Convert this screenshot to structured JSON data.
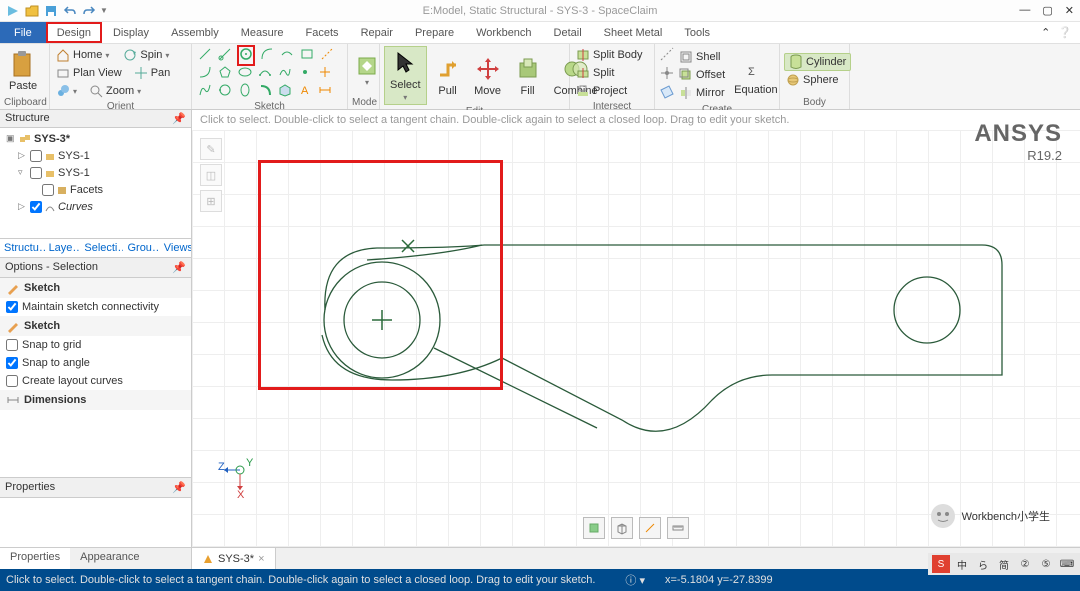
{
  "title": "E:Model, Static Structural - SYS-3 - SpaceClaim",
  "menu": {
    "file": "File",
    "tabs": [
      "Design",
      "Display",
      "Assembly",
      "Measure",
      "Facets",
      "Repair",
      "Prepare",
      "Workbench",
      "Detail",
      "Sheet Metal",
      "Tools"
    ]
  },
  "ribbon": {
    "clipboard": {
      "label": "Clipboard",
      "paste": "Paste"
    },
    "orient": {
      "label": "Orient",
      "home": "Home",
      "plan": "Plan View",
      "spin": "Spin",
      "pan": "Pan",
      "zoom": "Zoom"
    },
    "sketch": {
      "label": "Sketch"
    },
    "mode": {
      "label": "Mode"
    },
    "edit": {
      "label": "Edit",
      "select": "Select",
      "pull": "Pull",
      "move": "Move",
      "fill": "Fill",
      "combine": "Combine"
    },
    "intersect": {
      "label": "Intersect",
      "splitbody": "Split Body",
      "split": "Split",
      "project": "Project"
    },
    "create": {
      "label": "Create",
      "shell": "Shell",
      "offset": "Offset",
      "mirror": "Mirror",
      "equation": "Equation"
    },
    "body": {
      "label": "Body",
      "cylinder": "Cylinder",
      "sphere": "Sphere"
    }
  },
  "structure": {
    "title": "Structure",
    "root": "SYS-3*",
    "items": [
      "SYS-1",
      "SYS-1",
      "Facets",
      "Curves"
    ]
  },
  "paneltabs": [
    "Structu…",
    "Laye…",
    "Selecti…",
    "Grou…",
    "Views"
  ],
  "options": {
    "title": "Options - Selection",
    "sec1": "Sketch",
    "maintain": "Maintain sketch connectivity",
    "sec2": "Sketch",
    "grid": "Snap to grid",
    "angle": "Snap to angle",
    "layout": "Create layout curves",
    "dim": "Dimensions",
    "props": "Properties"
  },
  "bottomtabs": [
    "Properties",
    "Appearance"
  ],
  "doctab": "SYS-3*",
  "hint": "Click to select. Double-click to select a tangent chain. Double-click again to select a closed loop. Drag to edit your sketch.",
  "brand": {
    "name": "ANSYS",
    "ver": "R19.2"
  },
  "watermark": "Workbench小学生",
  "status": {
    "msg": "Click to select. Double-click to select a tangent chain. Double-click again to select a closed loop. Drag to edit your sketch.",
    "coords": "x=-5.1804 y=-27.8399"
  },
  "tray": [
    "S",
    "中",
    "ら",
    "简",
    "②",
    "⑤"
  ]
}
